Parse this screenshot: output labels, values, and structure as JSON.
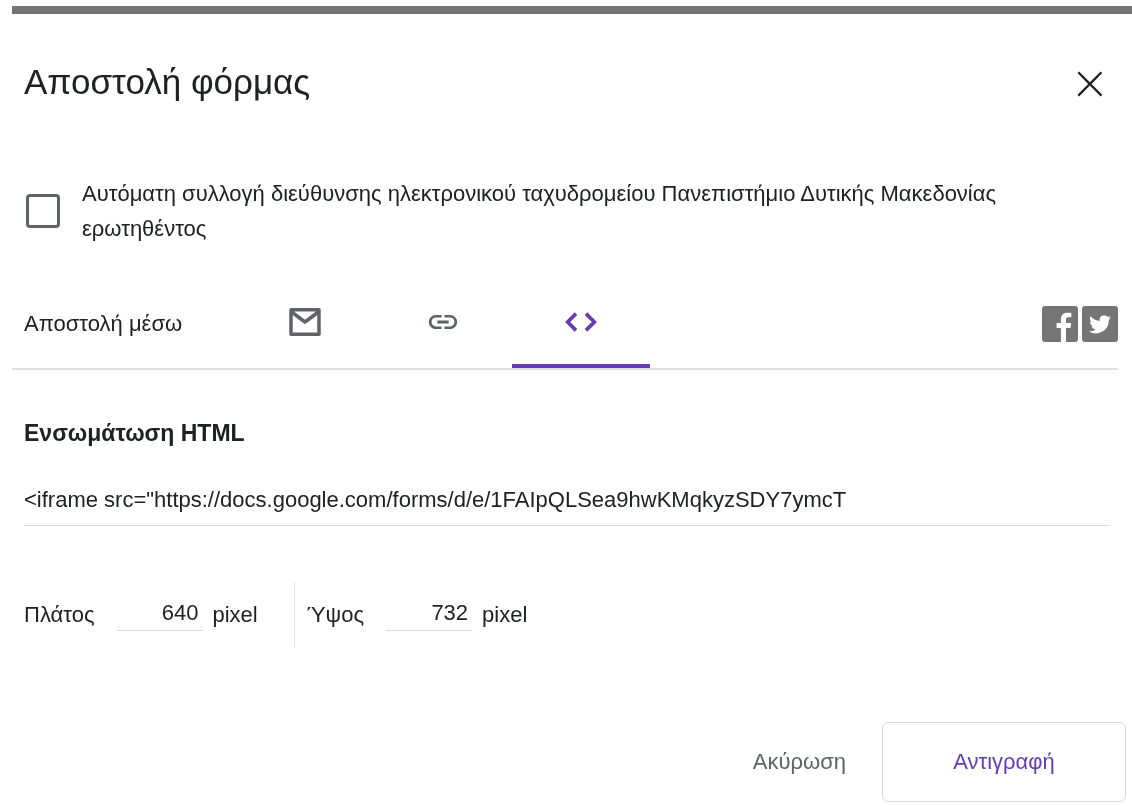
{
  "dialog": {
    "title": "Αποστολή φόρμας",
    "close": "×"
  },
  "collect_email": {
    "label": "Αυτόματη συλλογή διεύθυνσης ηλεκτρονικού ταχυδρομείου Πανεπιστήμιο Δυτικής Μακεδονίας ερωτηθέντος",
    "checked": false
  },
  "send_via": {
    "label": "Αποστολή μέσω",
    "tabs": [
      {
        "kind": "email",
        "selected": false
      },
      {
        "kind": "link",
        "selected": false
      },
      {
        "kind": "embed",
        "selected": true
      }
    ],
    "social": [
      {
        "kind": "facebook"
      },
      {
        "kind": "twitter"
      }
    ]
  },
  "embed": {
    "heading": "Ενσωμάτωση HTML",
    "code": "<iframe src=\"https://docs.google.com/forms/d/e/1FAIpQLSea9hwKMqkyzSDY7ymcT",
    "width": {
      "label": "Πλάτος",
      "value": "640",
      "unit": "pixel"
    },
    "height": {
      "label": "Ύψος",
      "value": "732",
      "unit": "pixel"
    }
  },
  "buttons": [
    {
      "label": "Ακύρωση",
      "kind": "text"
    },
    {
      "label": "Αντιγραφή",
      "kind": "outlined"
    }
  ]
}
